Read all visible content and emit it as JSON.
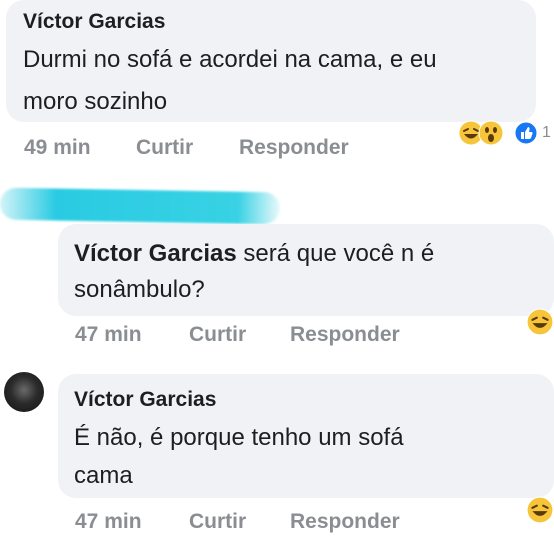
{
  "comments": [
    {
      "author": "Víctor Garcias",
      "text_line1": "Durmi no sofá e acordei na cama, e eu",
      "text_line2": "moro sozinho",
      "time": "49 min",
      "like": "Curtir",
      "reply": "Responder",
      "reaction_count": "1"
    },
    {
      "author": "Víctor Garcias",
      "text_inline": " será que você n é",
      "text_line2": "sonâmbulo?",
      "time": "47 min",
      "like": "Curtir",
      "reply": "Responder"
    },
    {
      "author": "Víctor Garcias",
      "text_line1": "É não, é porque tenho um sofá",
      "text_line2": "cama",
      "time": "47 min",
      "like": "Curtir",
      "reply": "Responder"
    }
  ],
  "colors": {
    "bubble": "#f0f2f5",
    "meta": "#8a8d91",
    "redaction": "#1ec8e1"
  },
  "icons": [
    "haha-reaction-icon",
    "wow-reaction-icon",
    "like-reaction-icon",
    "user-avatar"
  ]
}
